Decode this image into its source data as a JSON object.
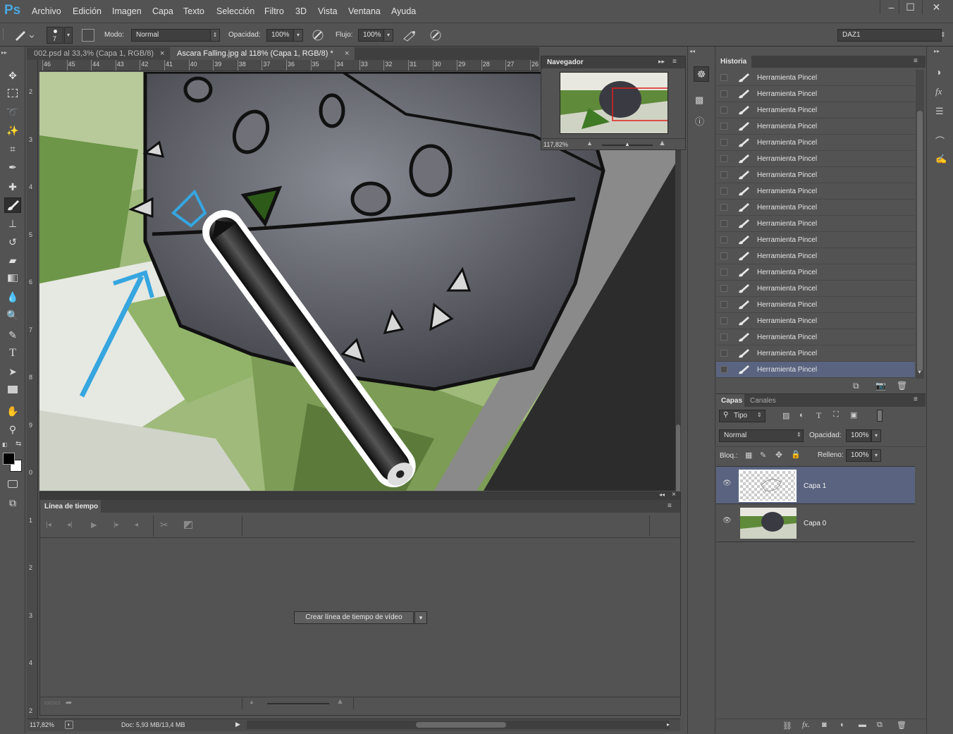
{
  "app": {
    "logo": "Ps"
  },
  "menu": [
    "Archivo",
    "Edición",
    "Imagen",
    "Capa",
    "Texto",
    "Selección",
    "Filtro",
    "3D",
    "Vista",
    "Ventana",
    "Ayuda"
  ],
  "window_controls": [
    "–",
    "☐",
    "✕"
  ],
  "options": {
    "brush_size": "7",
    "mode_label": "Modo:",
    "mode_value": "Normal",
    "opacity_label": "Opacidad:",
    "opacity_value": "100%",
    "flow_label": "Flujo:",
    "flow_value": "100%",
    "workspace": "DAZ1"
  },
  "tabs": [
    {
      "label": "002.psd al 33,3% (Capa 1, RGB/8)",
      "active": false
    },
    {
      "label": "Ascara Falling.jpg al 118% (Capa 1, RGB/8) *",
      "active": true
    }
  ],
  "ruler_top": [
    "46",
    "45",
    "44",
    "43",
    "42",
    "41",
    "40",
    "39",
    "38",
    "37",
    "36",
    "35",
    "34",
    "33",
    "32",
    "31",
    "30",
    "29",
    "28",
    "27",
    "26"
  ],
  "ruler_left": [
    "2",
    "3",
    "4",
    "5",
    "6",
    "7",
    "8",
    "9",
    "0",
    "1",
    "2",
    "3",
    "4",
    "2"
  ],
  "navigator": {
    "title": "Navegador",
    "zoom": "117,82%"
  },
  "timeline": {
    "title": "Línea de tiempo",
    "create_button": "Crear línea de tiempo de vídeo"
  },
  "status": {
    "zoom": "117,82%",
    "doc": "Doc: 5,93 MB/13,4 MB"
  },
  "history": {
    "title": "Historia",
    "items": [
      "Herramienta Pincel",
      "Herramienta Pincel",
      "Herramienta Pincel",
      "Herramienta Pincel",
      "Herramienta Pincel",
      "Herramienta Pincel",
      "Herramienta Pincel",
      "Herramienta Pincel",
      "Herramienta Pincel",
      "Herramienta Pincel",
      "Herramienta Pincel",
      "Herramienta Pincel",
      "Herramienta Pincel",
      "Herramienta Pincel",
      "Herramienta Pincel",
      "Herramienta Pincel",
      "Herramienta Pincel",
      "Herramienta Pincel",
      "Herramienta Pincel"
    ]
  },
  "layers": {
    "tabs": [
      "Capas",
      "Canales"
    ],
    "filter": "Tipo",
    "blend_mode": "Normal",
    "opacity_label": "Opacidad:",
    "opacity_value": "100%",
    "lock_label": "Bloq.:",
    "fill_label": "Relleno:",
    "fill_value": "100%",
    "items": [
      {
        "name": "Capa 1",
        "selected": true
      },
      {
        "name": "Capa 0",
        "selected": false
      }
    ]
  },
  "colors": {
    "selection": "#5a6480",
    "accent": "#3aa0dc",
    "panel": "#535353"
  }
}
